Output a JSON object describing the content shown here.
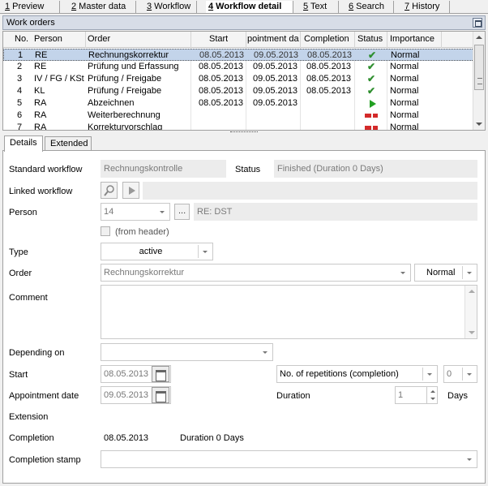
{
  "top_tabs": [
    {
      "key": "1",
      "label": " Preview"
    },
    {
      "key": "2",
      "label": " Master data"
    },
    {
      "key": "3",
      "label": " Workflow"
    },
    {
      "key": "4",
      "label": " Workflow detail"
    },
    {
      "key": "5",
      "label": " Text"
    },
    {
      "key": "6",
      "label": " Search"
    },
    {
      "key": "7",
      "label": " History"
    }
  ],
  "work_orders": {
    "title": "Work orders",
    "columns": [
      "No.",
      "Person",
      "Order",
      "Start",
      "pointment da",
      "Completion",
      "Status",
      "Importance"
    ],
    "rows": [
      {
        "no": "1",
        "person": "RE",
        "order": "Rechnungskorrektur",
        "start": "08.05.2013",
        "appointment": "09.05.2013",
        "completion": "08.05.2013",
        "status": "check",
        "importance": "Normal"
      },
      {
        "no": "2",
        "person": "RE",
        "order": "Prüfung und Erfassung",
        "start": "08.05.2013",
        "appointment": "09.05.2013",
        "completion": "08.05.2013",
        "status": "check",
        "importance": "Normal"
      },
      {
        "no": "3",
        "person": "IV / FG / KSt",
        "order": "Prüfung / Freigabe",
        "start": "08.05.2013",
        "appointment": "09.05.2013",
        "completion": "08.05.2013",
        "status": "check",
        "importance": "Normal"
      },
      {
        "no": "4",
        "person": "KL",
        "order": "Prüfung / Freigabe",
        "start": "08.05.2013",
        "appointment": "09.05.2013",
        "completion": "08.05.2013",
        "status": "check",
        "importance": "Normal"
      },
      {
        "no": "5",
        "person": "RA",
        "order": "Abzeichnen",
        "start": "08.05.2013",
        "appointment": "09.05.2013",
        "completion": "",
        "status": "play",
        "importance": "Normal"
      },
      {
        "no": "6",
        "person": "RA",
        "order": "Weiterberechnung",
        "start": "",
        "appointment": "",
        "completion": "",
        "status": "waiting",
        "importance": "Normal"
      },
      {
        "no": "7",
        "person": "RA",
        "order": "Korrekturvorschlag",
        "start": "",
        "appointment": "",
        "completion": "",
        "status": "waiting",
        "importance": "Normal"
      }
    ]
  },
  "detail_tabs": [
    "Details",
    "Extended"
  ],
  "details": {
    "standard_workflow_label": "Standard workflow",
    "standard_workflow_value": "Rechnungskontrolle",
    "status_label": "Status",
    "status_value": "Finished (Duration 0 Days)",
    "linked_workflow_label": "Linked workflow",
    "person_label": "Person",
    "person_value": "14",
    "person_button": "...",
    "person_name": "RE: DST",
    "from_header_label": "(from header)",
    "type_label": "Type",
    "type_value": "active",
    "order_label": "Order",
    "order_value": "Rechnungskorrektur",
    "importance_value": "Normal",
    "comment_label": "Comment",
    "depending_on_label": "Depending on",
    "start_label": "Start",
    "start_value": "08.05.2013",
    "repetitions_value": "No. of repetitions (completion)",
    "repetitions_count": "0",
    "appointment_label": "Appointment date",
    "appointment_value": "09.05.2013",
    "duration_label": "Duration",
    "duration_value": "1",
    "days_label": "Days",
    "extension_label": "Extension",
    "completion_label": "Completion",
    "completion_value": "08.05.2013",
    "completion_duration": "Duration 0 Days",
    "completion_stamp_label": "Completion stamp"
  }
}
